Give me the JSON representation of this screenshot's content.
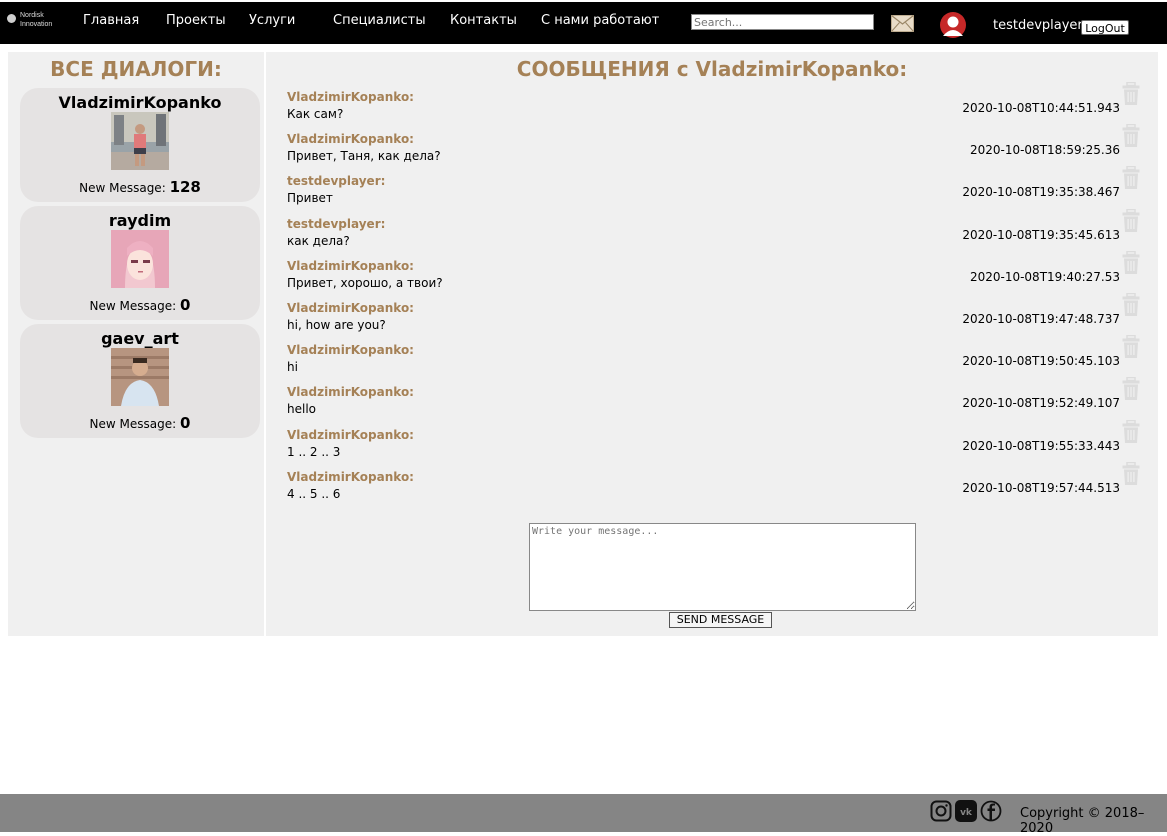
{
  "header": {
    "logo_text_1": "Nordisk",
    "logo_text_2": "Innovation",
    "nav": [
      "Главная",
      "Проекты",
      "Услуги",
      "Специалисты",
      "Контакты",
      "С нами работают"
    ],
    "search_placeholder": "Search...",
    "username": "testdevplayer",
    "logout_label": "LogOut"
  },
  "dialogs": {
    "title": "ВСЕ ДИАЛОГИ:",
    "new_message_label": "New Message:",
    "items": [
      {
        "name": "VladzimirKopanko",
        "count": "128"
      },
      {
        "name": "raydim",
        "count": "0"
      },
      {
        "name": "gaev_art",
        "count": "0"
      }
    ]
  },
  "chat": {
    "title": "СООБЩЕНИЯ с VladzimirKopanko:",
    "messages": [
      {
        "author": "VladzimirKopanko:",
        "text": "Как сам?",
        "time": "2020-10-08T10:44:51.943"
      },
      {
        "author": "VladzimirKopanko:",
        "text": "Привет, Таня, как дела?",
        "time": "2020-10-08T18:59:25.36"
      },
      {
        "author": "testdevplayer:",
        "text": "Привет",
        "time": "2020-10-08T19:35:38.467"
      },
      {
        "author": "testdevplayer:",
        "text": "как дела?",
        "time": "2020-10-08T19:35:45.613"
      },
      {
        "author": "VladzimirKopanko:",
        "text": "Привет, хорошо, а твои?",
        "time": "2020-10-08T19:40:27.53"
      },
      {
        "author": "VladzimirKopanko:",
        "text": "hi, how are you?",
        "time": "2020-10-08T19:47:48.737"
      },
      {
        "author": "VladzimirKopanko:",
        "text": "hi",
        "time": "2020-10-08T19:50:45.103"
      },
      {
        "author": "VladzimirKopanko:",
        "text": "hello",
        "time": "2020-10-08T19:52:49.107"
      },
      {
        "author": "VladzimirKopanko:",
        "text": "1 .. 2 .. 3",
        "time": "2020-10-08T19:55:33.443"
      },
      {
        "author": "VladzimirKopanko:",
        "text": "4 .. 5 .. 6",
        "time": "2020-10-08T19:57:44.513"
      }
    ],
    "input_placeholder": "Write your message...",
    "send_label": "SEND MESSAGE"
  },
  "footer": {
    "copyright": "Copyright © 2018–2020",
    "social_icons": [
      "instagram-icon",
      "vk-icon",
      "facebook-icon"
    ]
  },
  "colors": {
    "accent": "#a58156",
    "topbar": "#000000",
    "panel": "#f0f0f0",
    "card": "#e5e3e3",
    "footer": "#858585"
  }
}
